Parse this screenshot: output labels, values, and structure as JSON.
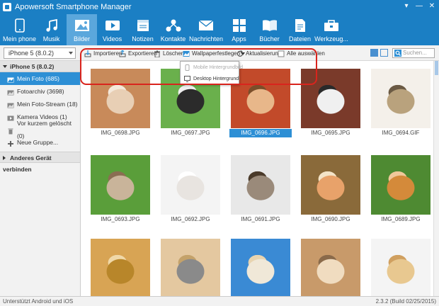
{
  "window": {
    "title": "Apowersoft Smartphone Manager",
    "controls": [
      "▾",
      "—",
      "✕"
    ]
  },
  "nav": [
    {
      "label": "Mein phone",
      "icon": "phone-icon"
    },
    {
      "label": "Musik",
      "icon": "music-icon"
    },
    {
      "label": "Bilder",
      "icon": "picture-icon",
      "active": true
    },
    {
      "label": "Videos",
      "icon": "video-icon"
    },
    {
      "label": "Notizen",
      "icon": "notes-icon"
    },
    {
      "label": "Kontakte",
      "icon": "contacts-icon"
    },
    {
      "label": "Nachrichten",
      "icon": "messages-icon"
    },
    {
      "label": "Apps",
      "icon": "apps-icon"
    },
    {
      "label": "Bücher",
      "icon": "books-icon"
    },
    {
      "label": "Dateien",
      "icon": "files-icon"
    },
    {
      "label": "Werkzeug...",
      "icon": "toolbox-icon"
    }
  ],
  "device_select": "iPhone 5 (8.0.2)",
  "toolbar": {
    "import": "Importieren",
    "export": "Exportieren",
    "delete": "Löschen",
    "wallpaper": "Wallpaperfestlegen",
    "refresh": "Aktualisierung",
    "select_all": "Alle auswählen"
  },
  "search": {
    "placeholder": "Suchen..."
  },
  "wallpaper_menu": [
    {
      "label": "Mobile Hintergrundbild",
      "disabled": true
    },
    {
      "label": "Desktop Hintergrund",
      "disabled": false
    }
  ],
  "sidebar": {
    "device": "iPhone 5 (8.0.2)",
    "items": [
      {
        "label": "Mein Foto (685)",
        "active": true
      },
      {
        "label": "Fotoarchiv (3698)"
      },
      {
        "label": "Mein Foto-Stream (18)"
      },
      {
        "label": "Kamera Videos (1)"
      },
      {
        "label": "Vor kurzem gelöscht (0)"
      },
      {
        "label": "Neue Gruppe..."
      }
    ],
    "other_device": "Anderes Gerät verbinden"
  },
  "photos": [
    {
      "name": "IMG_0698.JPG",
      "colors": [
        "#c88a5a",
        "#e8cfb5",
        "#f4e8da"
      ]
    },
    {
      "name": "IMG_0697.JPG",
      "colors": [
        "#6ab04c",
        "#2b2b2b",
        "#f0f0f0"
      ]
    },
    {
      "name": "IMG_0696.JPG",
      "colors": [
        "#c24a2a",
        "#e8b78a",
        "#7a4e2a"
      ],
      "selected": true
    },
    {
      "name": "IMG_0695.JPG",
      "colors": [
        "#7a3a2a",
        "#f0f0f0",
        "#2a2a2a"
      ]
    },
    {
      "name": "IMG_0694.GIF",
      "colors": [
        "#f4f0ea",
        "#b9a27d",
        "#6b5a44"
      ]
    },
    {
      "name": "IMG_0693.JPG",
      "colors": [
        "#5a9e3a",
        "#c9b49a",
        "#8a6e52"
      ]
    },
    {
      "name": "IMG_0692.JPG",
      "colors": [
        "#f4f4f4",
        "#e8e4e0",
        "#ffffff"
      ]
    },
    {
      "name": "IMG_0691.JPG",
      "colors": [
        "#e8e8e8",
        "#9a8a7a",
        "#4a3a2a"
      ]
    },
    {
      "name": "IMG_0690.JPG",
      "colors": [
        "#8a6a3a",
        "#e8a26a",
        "#f4e4c8"
      ]
    },
    {
      "name": "IMG_0689.JPG",
      "colors": [
        "#4e8a32",
        "#d48a3a",
        "#f0c89a"
      ]
    },
    {
      "name": "",
      "colors": [
        "#d8a454",
        "#b8862a",
        "#f0d8a8"
      ]
    },
    {
      "name": "",
      "colors": [
        "#e4c8a0",
        "#8a8a8a",
        "#c4a26a"
      ]
    },
    {
      "name": "",
      "colors": [
        "#3a8ad4",
        "#f0e8d8",
        "#e8d4b0"
      ]
    },
    {
      "name": "",
      "colors": [
        "#c89a6a",
        "#f0dcc0",
        "#8a6a4a"
      ]
    },
    {
      "name": "",
      "colors": [
        "#f4f4f4",
        "#e8c890",
        "#d0a060"
      ]
    }
  ],
  "status": {
    "left": "Unterstützt Android und iOS",
    "right": "2.3.2 (Build 02/25/2015)"
  },
  "colors": {
    "brand": "#1b7fc4",
    "active_nav": "#5ba7dc",
    "selection": "#2d8fd5",
    "highlight": "#d9241d"
  }
}
